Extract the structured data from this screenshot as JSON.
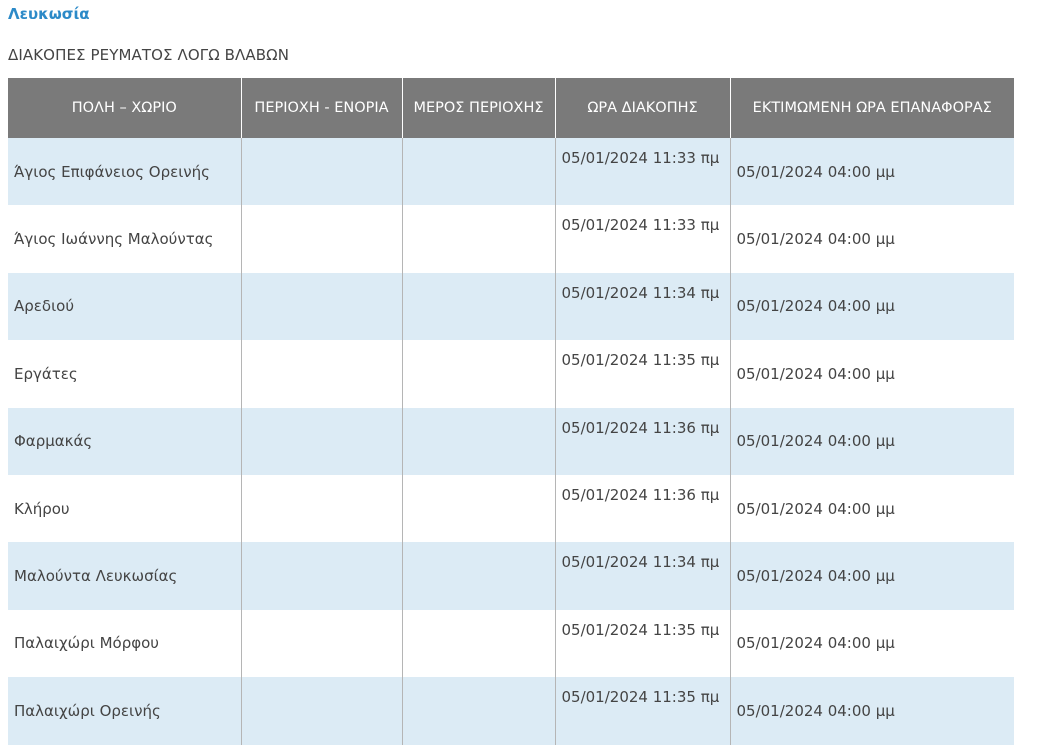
{
  "region": {
    "title": "Λευκωσία"
  },
  "section": {
    "heading": "ΔΙΑΚΟΠΕΣ ΡΕΥΜΑΤΟΣ ΛΟΓΩ ΒΛΑΒΩΝ"
  },
  "table": {
    "headers": [
      "ΠΟΛΗ – ΧΩΡΙΟ",
      "ΠΕΡΙΟΧΗ - ΕΝΟΡΙΑ",
      "ΜΕΡΟΣ ΠΕΡΙΟΧΗΣ",
      "ΩΡΑ ΔΙΑΚΟΠΗΣ",
      "ΕΚΤΙΜΩΜΕΝΗ ΩΡΑ ΕΠΑΝΑΦΟΡΑΣ"
    ],
    "rows": [
      [
        "Άγιος Επιφάνειος Ορεινής",
        "",
        "",
        "05/01/2024 11:33 πμ",
        "05/01/2024 04:00 μμ"
      ],
      [
        "Άγιος Ιωάννης Μαλούντας",
        "",
        "",
        "05/01/2024 11:33 πμ",
        "05/01/2024 04:00 μμ"
      ],
      [
        "Αρεδιού",
        "",
        "",
        "05/01/2024 11:34 πμ",
        "05/01/2024 04:00 μμ"
      ],
      [
        "Εργάτες",
        "",
        "",
        "05/01/2024 11:35 πμ",
        "05/01/2024 04:00 μμ"
      ],
      [
        "Φαρμακάς",
        "",
        "",
        "05/01/2024 11:36 πμ",
        "05/01/2024 04:00 μμ"
      ],
      [
        "Κλήρου",
        "",
        "",
        "05/01/2024 11:36 πμ",
        "05/01/2024 04:00 μμ"
      ],
      [
        "Μαλούντα Λευκωσίας",
        "",
        "",
        "05/01/2024 11:34 πμ",
        "05/01/2024 04:00 μμ"
      ],
      [
        "Παλαιχώρι Μόρφου",
        "",
        "",
        "05/01/2024 11:35 πμ",
        "05/01/2024 04:00 μμ"
      ],
      [
        "Παλαιχώρι Ορεινής",
        "",
        "",
        "05/01/2024 11:35 πμ",
        "05/01/2024 04:00 μμ"
      ]
    ]
  },
  "colors": {
    "link": "#2c8ac8",
    "header_bg": "#7a7a7a",
    "row_stripe": "#dcebf5",
    "text": "#444444"
  }
}
